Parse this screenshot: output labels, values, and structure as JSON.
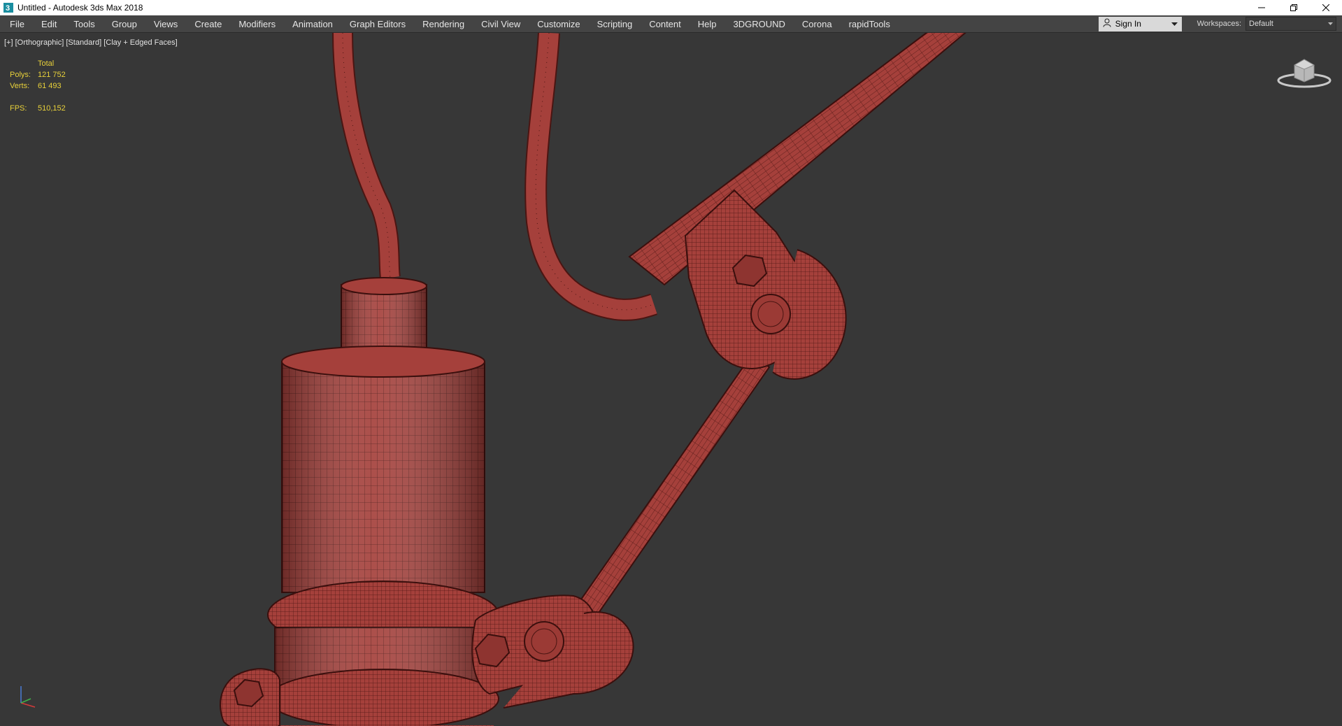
{
  "window": {
    "title": "Untitled - Autodesk 3ds Max 2018",
    "app_icon": "3dsmax-logo-icon",
    "controls": [
      "minimize-icon",
      "restore-icon",
      "close-icon"
    ]
  },
  "menubar": {
    "items": [
      "File",
      "Edit",
      "Tools",
      "Group",
      "Views",
      "Create",
      "Modifiers",
      "Animation",
      "Graph Editors",
      "Rendering",
      "Civil View",
      "Customize",
      "Scripting",
      "Content",
      "Help",
      "3DGROUND",
      "Corona",
      "rapidTools"
    ],
    "sign_in": "Sign In",
    "workspaces_label": "Workspaces:",
    "workspace_value": "Default"
  },
  "viewport": {
    "label_plus": "[+]",
    "label_view": "[Orthographic]",
    "label_shading": "[Standard]",
    "label_mode": "[Clay + Edged Faces]",
    "stats": {
      "header": "Total",
      "polys_label": "Polys:",
      "polys": "121 752",
      "verts_label": "Verts:",
      "verts": "61 493",
      "fps_label": "FPS:",
      "fps": "510,152"
    }
  },
  "colors": {
    "viewport_bg": "#373737",
    "clay": "#a5403b",
    "wire": "#4a1512",
    "stats_text": "#e8d13a"
  }
}
